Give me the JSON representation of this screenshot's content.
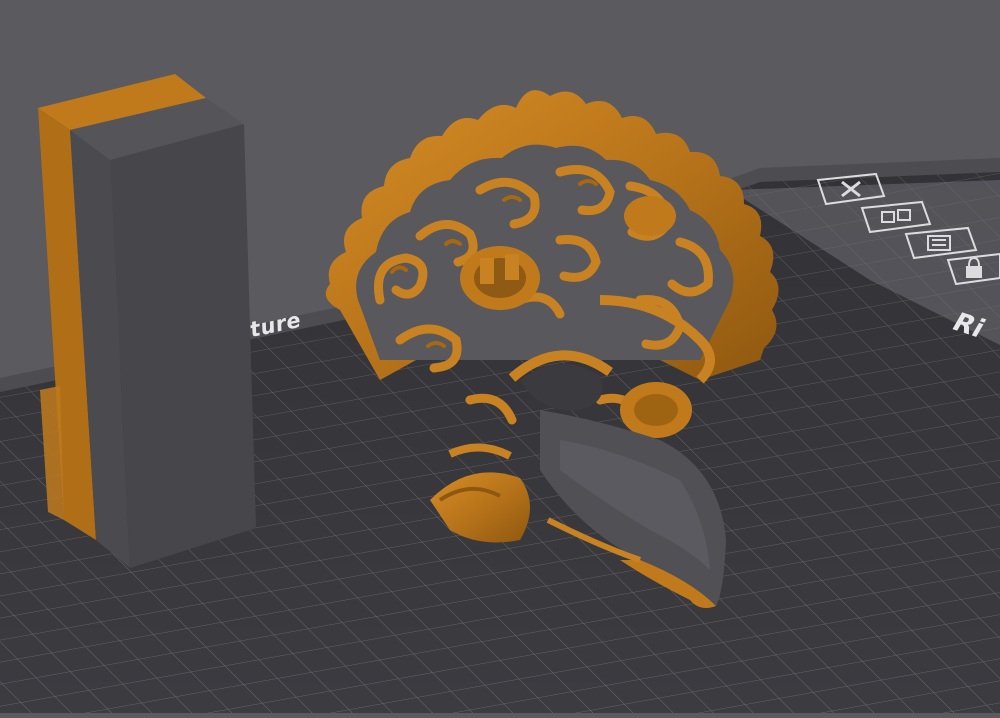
{
  "viewport": {
    "bed_label": "ture",
    "plate_label": "Ri",
    "background_color": "#5a5a5f",
    "bed_color": "#3b3b40",
    "grid_color": "#6a6a70",
    "model_color": "#c07a1c",
    "model_shadow_color": "#4d4d52"
  },
  "plate_toolbar": {
    "items": [
      {
        "icon": "close-icon"
      },
      {
        "icon": "arrange-icon"
      },
      {
        "icon": "orient-icon"
      },
      {
        "icon": "lock-icon"
      }
    ]
  }
}
